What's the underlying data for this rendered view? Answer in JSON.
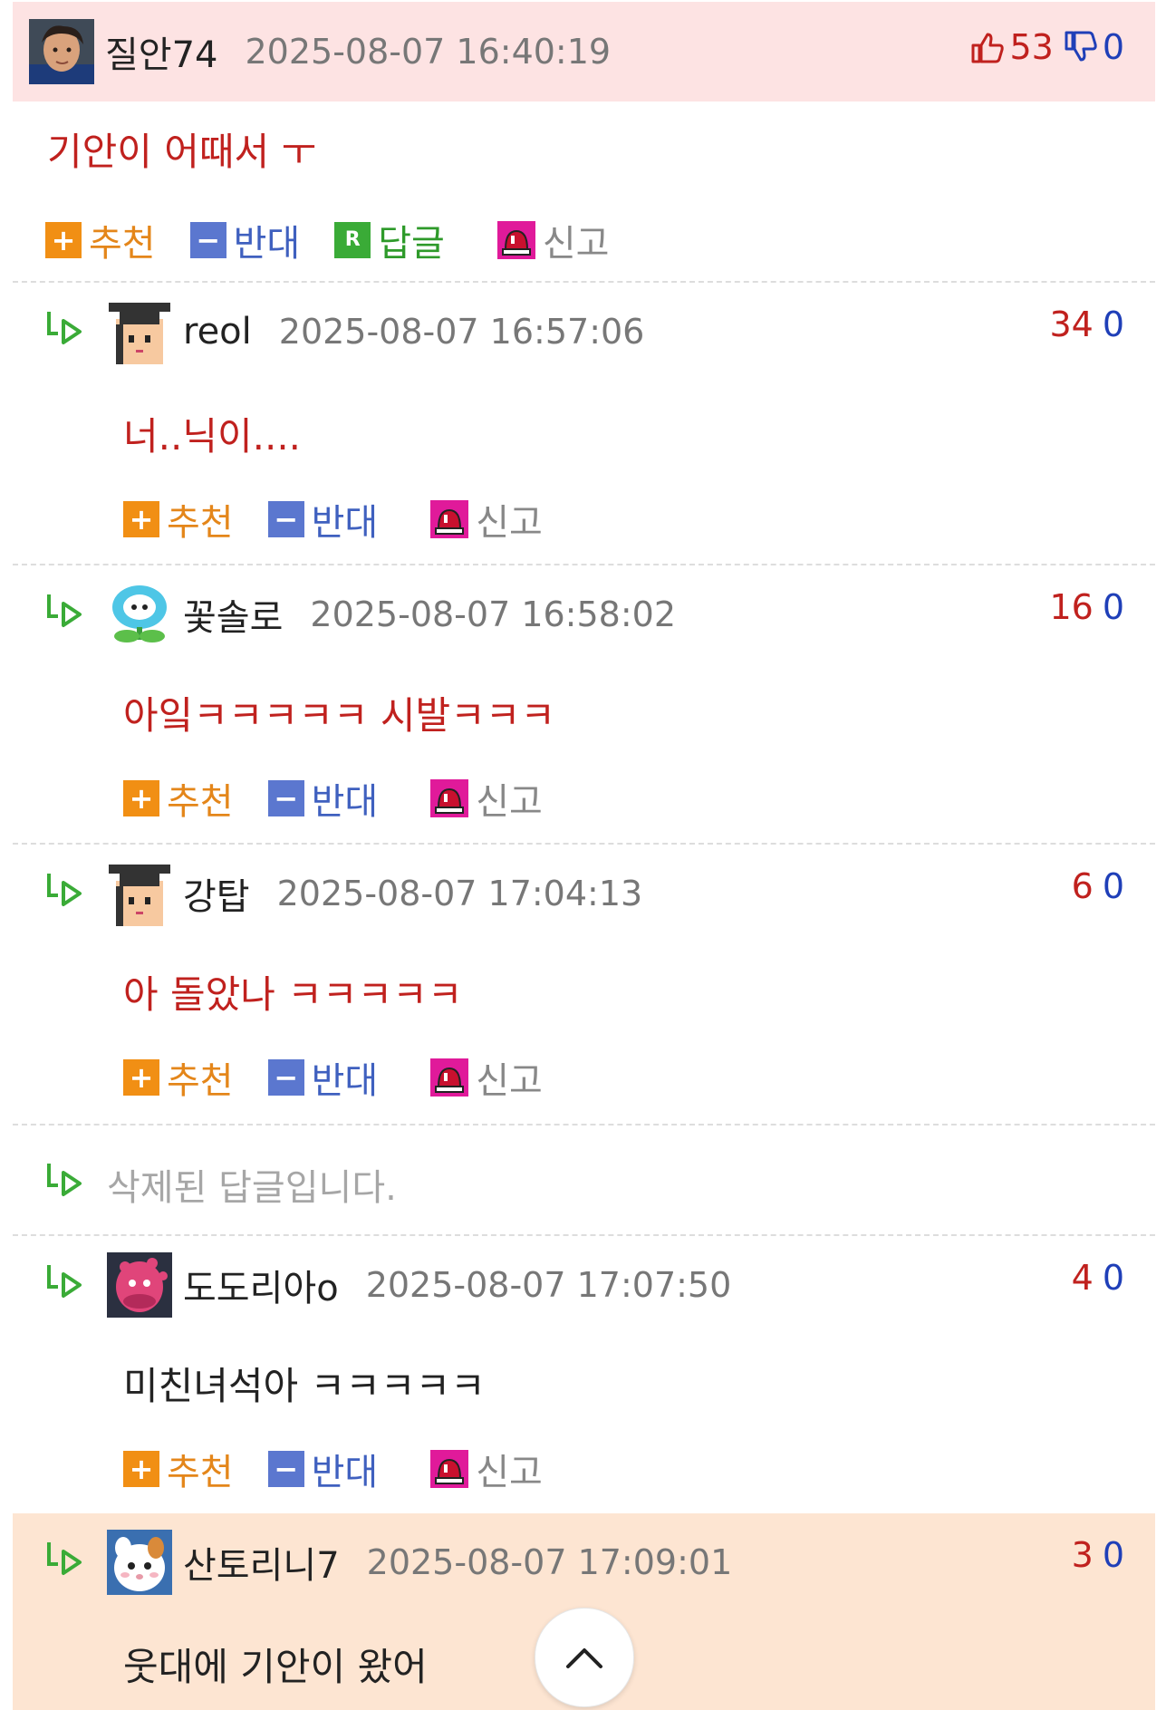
{
  "main_comment": {
    "nickname": "질안74",
    "date": "2025-08-07 16:40:19",
    "upvotes": "53",
    "downvotes": "0",
    "body": "기안이 어때서 ㅜ",
    "actions": {
      "recommend": "추천",
      "oppose": "반대",
      "reply": "답글",
      "report": "신고"
    }
  },
  "replies": [
    {
      "nickname": "reol",
      "date": "2025-08-07 16:57:06",
      "upvotes": "34",
      "downvotes": "0",
      "body": "너..닉이....",
      "recommend": "추천",
      "oppose": "반대",
      "report": "신고"
    },
    {
      "nickname": "꽃솔로",
      "date": "2025-08-07 16:58:02",
      "upvotes": "16",
      "downvotes": "0",
      "body": "아잌ㅋㅋㅋㅋㅋ 시발ㅋㅋㅋ",
      "recommend": "추천",
      "oppose": "반대",
      "report": "신고"
    },
    {
      "nickname": "강탑",
      "date": "2025-08-07 17:04:13",
      "upvotes": "6",
      "downvotes": "0",
      "body": "아 돌았나 ㅋㅋㅋㅋㅋ",
      "recommend": "추천",
      "oppose": "반대",
      "report": "신고"
    },
    {
      "nickname": "도도리아o",
      "date": "2025-08-07 17:07:50",
      "upvotes": "4",
      "downvotes": "0",
      "body": "미친녀석아 ㅋㅋㅋㅋㅋ",
      "recommend": "추천",
      "oppose": "반대",
      "report": "신고"
    },
    {
      "nickname": "산토리니7",
      "date": "2025-08-07 17:09:01",
      "upvotes": "3",
      "downvotes": "0",
      "body": "웃대에 기안이 왔어"
    }
  ],
  "deleted_reply_text": "삭제된 답글입니다.",
  "icons": {
    "reply_arrow": "reply-arrow-icon",
    "thumb_up": "thumb-up-icon",
    "thumb_down": "thumb-down-icon",
    "report": "siren-icon",
    "scroll_top": "chevron-up-icon"
  },
  "colors": {
    "main_header_bg": "#fde3e3",
    "highlight_bg": "#fde5d2",
    "red_text": "#c0211e",
    "blue_text": "#1f3fb8",
    "green_arrow": "#3aab37"
  }
}
